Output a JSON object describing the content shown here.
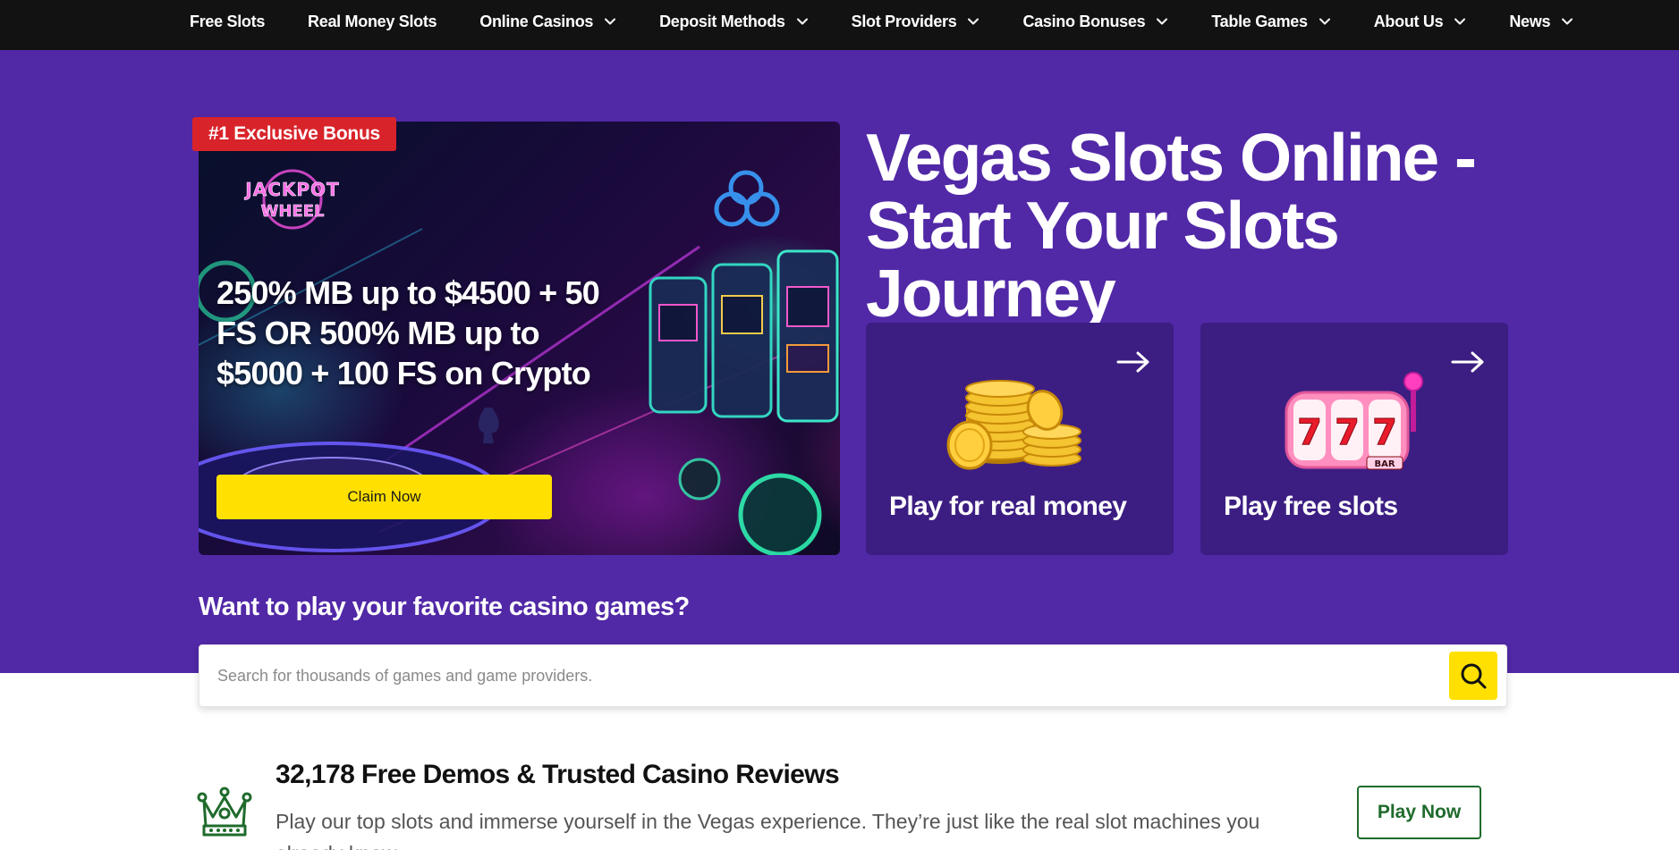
{
  "nav": {
    "items": [
      {
        "label": "Free Slots",
        "has_dropdown": false
      },
      {
        "label": "Real Money Slots",
        "has_dropdown": false
      },
      {
        "label": "Online Casinos",
        "has_dropdown": true
      },
      {
        "label": "Deposit Methods",
        "has_dropdown": true
      },
      {
        "label": "Slot Providers",
        "has_dropdown": true
      },
      {
        "label": "Casino Bonuses",
        "has_dropdown": true
      },
      {
        "label": "Table Games",
        "has_dropdown": true
      },
      {
        "label": "About Us",
        "has_dropdown": true
      },
      {
        "label": "News",
        "has_dropdown": true
      }
    ]
  },
  "bonus": {
    "badge": "#1 Exclusive Bonus",
    "brand_line1": "JACKPOT",
    "brand_line2": "WHEEL",
    "offer": "250% MB up to $4500 + 50 FS OR 500% MB up to $5000 + 100 FS on Crypto",
    "cta": "Claim Now"
  },
  "hero": {
    "title": "Vegas Slots Online - Start Your Slots Journey"
  },
  "tiles": {
    "real": {
      "label": "Play for real money",
      "icon": "coins-icon"
    },
    "free": {
      "label": "Play free slots",
      "icon": "slot-machine-icon",
      "reel_symbols": "777",
      "reel_bar": "BAR"
    }
  },
  "search": {
    "heading": "Want to play your favorite casino games?",
    "placeholder": "Search for thousands of games and game providers."
  },
  "intro": {
    "title": "32,178 Free Demos & Trusted Casino Reviews",
    "description": "Play our top slots and immerse yourself in the Vegas experience. They’re just like the real slot machines you already know",
    "cta": "Play Now"
  },
  "colors": {
    "nav_bg": "#121212",
    "hero_bg": "#5128a6",
    "tile_bg": "#3c1e82",
    "accent_yellow": "#ffe000",
    "badge_red": "#d8232a",
    "green": "#1f6b2c"
  }
}
